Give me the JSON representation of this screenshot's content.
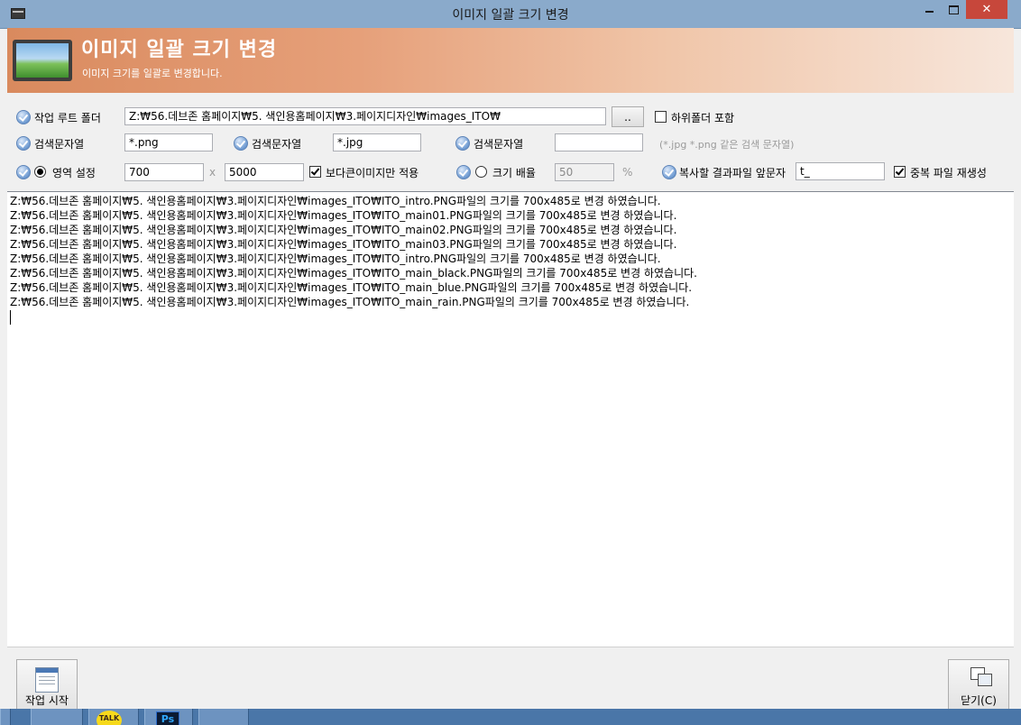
{
  "window": {
    "title": "이미지 일괄 크기 변경"
  },
  "banner": {
    "title": "이미지 일괄 크기 변경",
    "subtitle": "이미지 크기를 일괄로 변경합니다."
  },
  "form": {
    "root_folder": {
      "label": "작업 루트 폴더",
      "value": "Z:₩56.데브존 홈페이지₩5. 색인용홈페이지₩3.페이지디자인₩images_ITO₩",
      "browse_label": "..",
      "include_sub_label": "하위폴더 포함",
      "include_sub_checked": false
    },
    "search1": {
      "label": "검색문자열",
      "value": "*.png"
    },
    "search2": {
      "label": "검색문자열",
      "value": "*.jpg"
    },
    "search3": {
      "label": "검색문자열",
      "value": "",
      "hint": "(*.jpg *.png 같은 검색 문자열)"
    },
    "area": {
      "label": "영역 설정",
      "selected": true,
      "width": "700",
      "sep": "x",
      "height": "5000",
      "larger_only_label": "보다큰이미지만 적용",
      "larger_only_checked": true
    },
    "scale": {
      "label": "크기 배율",
      "selected": false,
      "value": "50",
      "unit": "%"
    },
    "prefix": {
      "label": "복사할 결과파일 앞문자",
      "value": "t_"
    },
    "regen": {
      "label": "중복 파일 재생성",
      "checked": true
    }
  },
  "log": [
    "Z:₩56.데브존 홈페이지₩5. 색인용홈페이지₩3.페이지디자인₩images_ITO₩ITO_intro.PNG파일의 크기를 700x485로 변경 하였습니다.",
    "Z:₩56.데브존 홈페이지₩5. 색인용홈페이지₩3.페이지디자인₩images_ITO₩ITO_main01.PNG파일의 크기를 700x485로 변경 하였습니다.",
    "Z:₩56.데브존 홈페이지₩5. 색인용홈페이지₩3.페이지디자인₩images_ITO₩ITO_main02.PNG파일의 크기를 700x485로 변경 하였습니다.",
    "Z:₩56.데브존 홈페이지₩5. 색인용홈페이지₩3.페이지디자인₩images_ITO₩ITO_main03.PNG파일의 크기를 700x485로 변경 하였습니다.",
    "Z:₩56.데브존 홈페이지₩5. 색인용홈페이지₩3.페이지디자인₩images_ITO₩ITO_intro.PNG파일의 크기를 700x485로 변경 하였습니다.",
    "Z:₩56.데브존 홈페이지₩5. 색인용홈페이지₩3.페이지디자인₩images_ITO₩ITO_main_black.PNG파일의 크기를 700x485로 변경 하였습니다.",
    "Z:₩56.데브존 홈페이지₩5. 색인용홈페이지₩3.페이지디자인₩images_ITO₩ITO_main_blue.PNG파일의 크기를 700x485로 변경 하였습니다.",
    "Z:₩56.데브존 홈페이지₩5. 색인용홈페이지₩3.페이지디자인₩images_ITO₩ITO_main_rain.PNG파일의 크기를 700x485로 변경 하였습니다."
  ],
  "buttons": {
    "start": "작업 시작",
    "close": "닫기(C)"
  },
  "taskbar": {
    "talk_label": "TALK",
    "ps_label": "Ps"
  },
  "colors": {
    "titlebar": "#8aaacb",
    "banner_start": "#d98a5e",
    "close_button": "#c7473b",
    "taskbar": "#4a76a8"
  }
}
